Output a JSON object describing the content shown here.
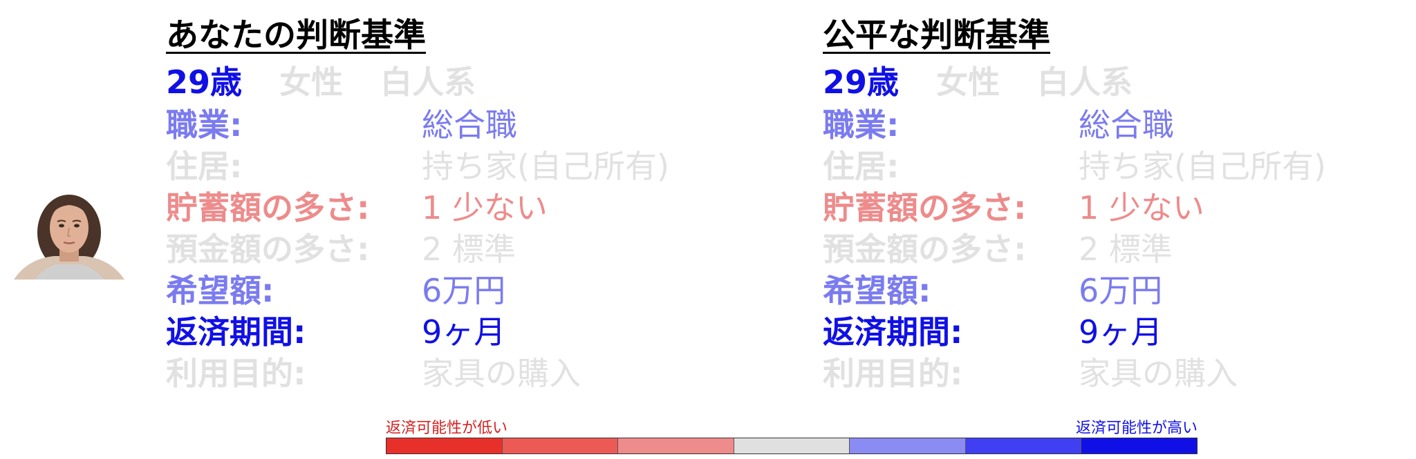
{
  "left": {
    "title": "あなたの判断基準",
    "age": "29歳",
    "gender": "女性",
    "ethnicity": "白人系",
    "rows": [
      {
        "label": "職業:",
        "value": "総合職",
        "level": "light-blue"
      },
      {
        "label": "住居:",
        "value": "持ち家(自己所有)",
        "level": "gray"
      },
      {
        "label": "貯蓄額の多さ:",
        "value": "1 少ない",
        "level": "red"
      },
      {
        "label": "預金額の多さ:",
        "value": "2 標準",
        "level": "gray"
      },
      {
        "label": "希望額:",
        "value": "6万円",
        "level": "light-blue"
      },
      {
        "label": "返済期間:",
        "value": "9ヶ月",
        "level": "blue"
      },
      {
        "label": "利用目的:",
        "value": "家具の購入",
        "level": "gray"
      }
    ]
  },
  "right": {
    "title": "公平な判断基準",
    "age": "29歳",
    "gender": "女性",
    "ethnicity": "白人系",
    "rows": [
      {
        "label": "職業:",
        "value": "総合職",
        "level": "light-blue"
      },
      {
        "label": "住居:",
        "value": "持ち家(自己所有)",
        "level": "gray"
      },
      {
        "label": "貯蓄額の多さ:",
        "value": "1 少ない",
        "level": "red"
      },
      {
        "label": "預金額の多さ:",
        "value": "2 標準",
        "level": "gray"
      },
      {
        "label": "希望額:",
        "value": "6万円",
        "level": "light-blue"
      },
      {
        "label": "返済期間:",
        "value": "9ヶ月",
        "level": "blue"
      },
      {
        "label": "利用目的:",
        "value": "家具の購入",
        "level": "gray"
      }
    ]
  },
  "legend": {
    "low_label": "返済可能性が低い",
    "high_label": "返済可能性が高い",
    "colors": [
      "#e8302a",
      "#ec5a55",
      "#ee8b8b",
      "#e0e0e0",
      "#8b8bf4",
      "#4040f2",
      "#1010e6"
    ]
  },
  "colors": {
    "blue": "#1010e6",
    "light_blue": "#7b7bf0",
    "gray": "#e1e1e1",
    "red": "#ee8b8b"
  }
}
